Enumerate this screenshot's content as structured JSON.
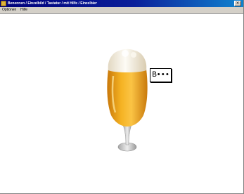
{
  "window": {
    "title": "Benennen / Einzelbild / Tastatur / mit Hilfe / Einzelbier",
    "close_glyph": "×"
  },
  "menu": {
    "items": [
      "Optionen",
      "Hilfe"
    ]
  },
  "main": {
    "image": {
      "name": "beer-glass-image",
      "alt": "Glass of beer"
    },
    "word_hint": "B•••"
  },
  "colors": {
    "titlebar_start": "#00007b",
    "titlebar_end": "#1084d0",
    "menubar_bg": "#d4d0c8",
    "beer": "#f0a81c",
    "foam": "#f6f1e4"
  }
}
